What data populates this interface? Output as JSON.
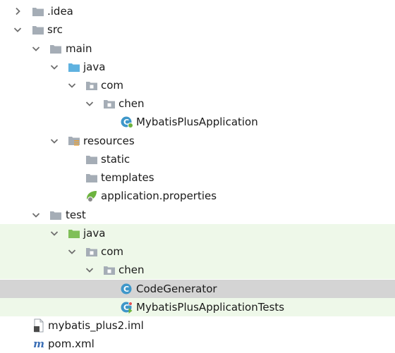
{
  "tree": {
    "idea": ".idea",
    "src": "src",
    "main": "main",
    "main_java": "java",
    "main_com": "com",
    "main_chen": "chen",
    "main_class": "MybatisPlusApplication",
    "resources": "resources",
    "static": "static",
    "templates": "templates",
    "app_properties": "application.properties",
    "test": "test",
    "test_java": "java",
    "test_com": "com",
    "test_chen": "chen",
    "code_generator": "CodeGenerator",
    "tests_class": "MybatisPlusApplicationTests",
    "iml": "mybatis_plus2.iml",
    "pom": "pom.xml"
  },
  "colors": {
    "test_sources_bg": "#eef8e9",
    "selected_bg": "#d4d4d4",
    "folder_gray": "#a5adb6",
    "folder_blue": "#5fb2e0",
    "folder_green": "#7fbf58",
    "class_icon": "#3e97c9",
    "maven_blue": "#3b6fb6"
  }
}
